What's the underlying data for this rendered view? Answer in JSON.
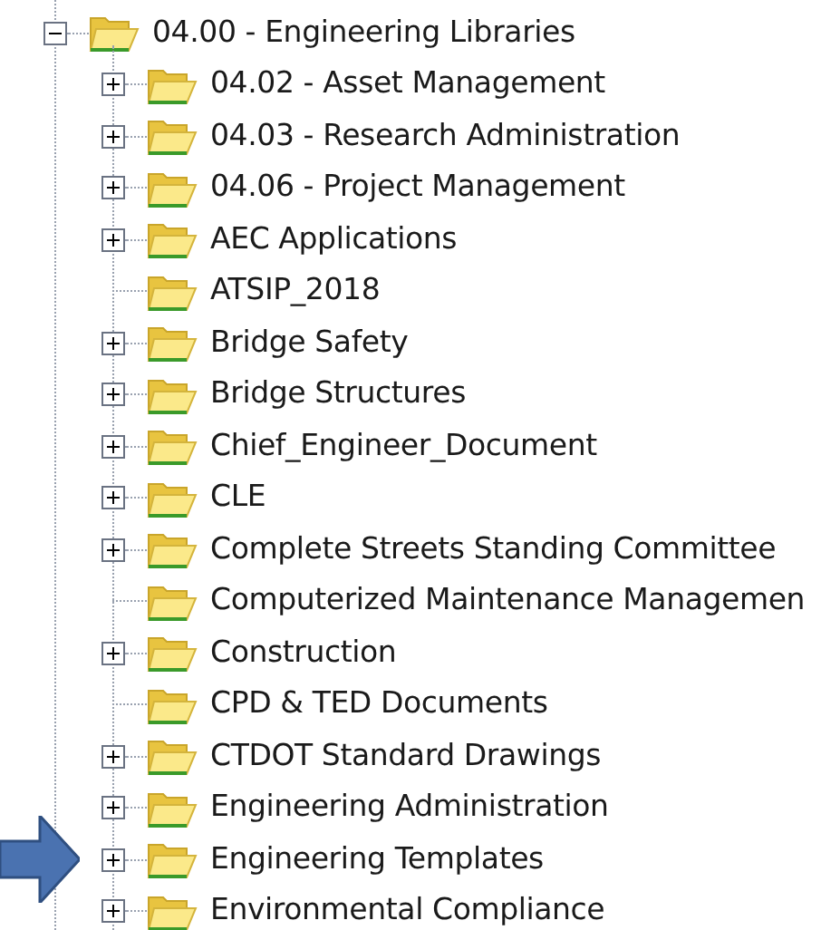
{
  "tree": {
    "label": "04.00 - Engineering Libraries",
    "expanded": true,
    "children": [
      {
        "label": "04.02 - Asset Management",
        "has_children": true,
        "expanded": false
      },
      {
        "label": "04.03 - Research Administration",
        "has_children": true,
        "expanded": false
      },
      {
        "label": "04.06 - Project Management",
        "has_children": true,
        "expanded": false
      },
      {
        "label": "AEC Applications",
        "has_children": true,
        "expanded": false
      },
      {
        "label": "ATSIP_2018",
        "has_children": false
      },
      {
        "label": "Bridge Safety",
        "has_children": true,
        "expanded": false
      },
      {
        "label": "Bridge Structures",
        "has_children": true,
        "expanded": false
      },
      {
        "label": "Chief_Engineer_Document",
        "has_children": true,
        "expanded": false
      },
      {
        "label": "CLE",
        "has_children": true,
        "expanded": false
      },
      {
        "label": "Complete Streets Standing Committee",
        "has_children": true,
        "expanded": false
      },
      {
        "label": "Computerized Maintenance Managemen",
        "has_children": false
      },
      {
        "label": "Construction",
        "has_children": true,
        "expanded": false
      },
      {
        "label": "CPD & TED Documents",
        "has_children": false
      },
      {
        "label": "CTDOT Standard Drawings",
        "has_children": true,
        "expanded": false
      },
      {
        "label": "Engineering Administration",
        "has_children": true,
        "expanded": false
      },
      {
        "label": "Engineering Templates",
        "has_children": true,
        "expanded": false
      },
      {
        "label": "Environmental Compliance",
        "has_children": true,
        "expanded": false
      }
    ]
  }
}
